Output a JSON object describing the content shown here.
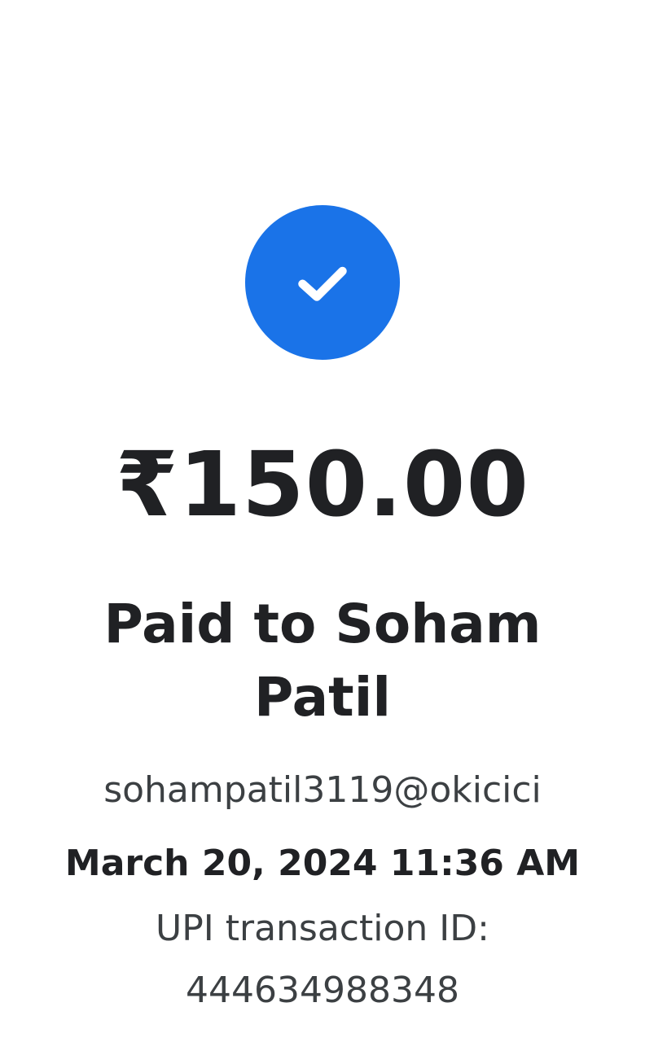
{
  "status": {
    "icon": "check-circle-icon",
    "color": "#1a73e8"
  },
  "payment": {
    "amount": "₹150.00",
    "paid_to": "Paid to Soham Patil",
    "upi_id": "sohampatil3119@okicici",
    "datetime": "March 20, 2024 11:36 AM",
    "txn_label": "UPI transaction ID:",
    "txn_id": "444634988348"
  }
}
